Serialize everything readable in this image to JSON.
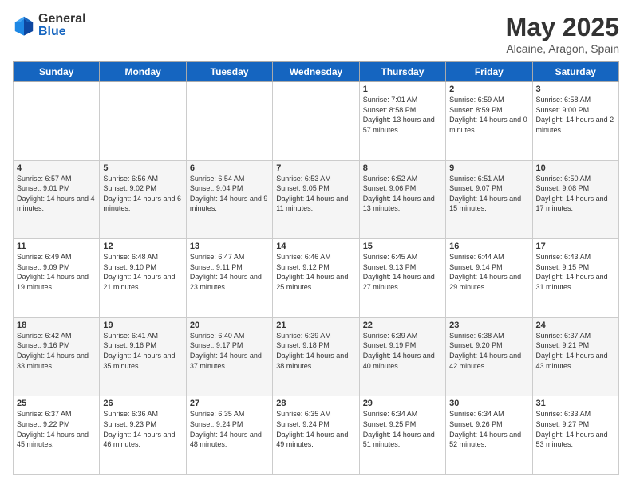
{
  "header": {
    "logo_general": "General",
    "logo_blue": "Blue",
    "title": "May 2025",
    "location": "Alcaine, Aragon, Spain"
  },
  "days_of_week": [
    "Sunday",
    "Monday",
    "Tuesday",
    "Wednesday",
    "Thursday",
    "Friday",
    "Saturday"
  ],
  "weeks": [
    [
      {
        "day": "",
        "sunrise": "",
        "sunset": "",
        "daylight": ""
      },
      {
        "day": "",
        "sunrise": "",
        "sunset": "",
        "daylight": ""
      },
      {
        "day": "",
        "sunrise": "",
        "sunset": "",
        "daylight": ""
      },
      {
        "day": "",
        "sunrise": "",
        "sunset": "",
        "daylight": ""
      },
      {
        "day": "1",
        "sunrise": "Sunrise: 7:01 AM",
        "sunset": "Sunset: 8:58 PM",
        "daylight": "Daylight: 13 hours and 57 minutes."
      },
      {
        "day": "2",
        "sunrise": "Sunrise: 6:59 AM",
        "sunset": "Sunset: 8:59 PM",
        "daylight": "Daylight: 14 hours and 0 minutes."
      },
      {
        "day": "3",
        "sunrise": "Sunrise: 6:58 AM",
        "sunset": "Sunset: 9:00 PM",
        "daylight": "Daylight: 14 hours and 2 minutes."
      }
    ],
    [
      {
        "day": "4",
        "sunrise": "Sunrise: 6:57 AM",
        "sunset": "Sunset: 9:01 PM",
        "daylight": "Daylight: 14 hours and 4 minutes."
      },
      {
        "day": "5",
        "sunrise": "Sunrise: 6:56 AM",
        "sunset": "Sunset: 9:02 PM",
        "daylight": "Daylight: 14 hours and 6 minutes."
      },
      {
        "day": "6",
        "sunrise": "Sunrise: 6:54 AM",
        "sunset": "Sunset: 9:04 PM",
        "daylight": "Daylight: 14 hours and 9 minutes."
      },
      {
        "day": "7",
        "sunrise": "Sunrise: 6:53 AM",
        "sunset": "Sunset: 9:05 PM",
        "daylight": "Daylight: 14 hours and 11 minutes."
      },
      {
        "day": "8",
        "sunrise": "Sunrise: 6:52 AM",
        "sunset": "Sunset: 9:06 PM",
        "daylight": "Daylight: 14 hours and 13 minutes."
      },
      {
        "day": "9",
        "sunrise": "Sunrise: 6:51 AM",
        "sunset": "Sunset: 9:07 PM",
        "daylight": "Daylight: 14 hours and 15 minutes."
      },
      {
        "day": "10",
        "sunrise": "Sunrise: 6:50 AM",
        "sunset": "Sunset: 9:08 PM",
        "daylight": "Daylight: 14 hours and 17 minutes."
      }
    ],
    [
      {
        "day": "11",
        "sunrise": "Sunrise: 6:49 AM",
        "sunset": "Sunset: 9:09 PM",
        "daylight": "Daylight: 14 hours and 19 minutes."
      },
      {
        "day": "12",
        "sunrise": "Sunrise: 6:48 AM",
        "sunset": "Sunset: 9:10 PM",
        "daylight": "Daylight: 14 hours and 21 minutes."
      },
      {
        "day": "13",
        "sunrise": "Sunrise: 6:47 AM",
        "sunset": "Sunset: 9:11 PM",
        "daylight": "Daylight: 14 hours and 23 minutes."
      },
      {
        "day": "14",
        "sunrise": "Sunrise: 6:46 AM",
        "sunset": "Sunset: 9:12 PM",
        "daylight": "Daylight: 14 hours and 25 minutes."
      },
      {
        "day": "15",
        "sunrise": "Sunrise: 6:45 AM",
        "sunset": "Sunset: 9:13 PM",
        "daylight": "Daylight: 14 hours and 27 minutes."
      },
      {
        "day": "16",
        "sunrise": "Sunrise: 6:44 AM",
        "sunset": "Sunset: 9:14 PM",
        "daylight": "Daylight: 14 hours and 29 minutes."
      },
      {
        "day": "17",
        "sunrise": "Sunrise: 6:43 AM",
        "sunset": "Sunset: 9:15 PM",
        "daylight": "Daylight: 14 hours and 31 minutes."
      }
    ],
    [
      {
        "day": "18",
        "sunrise": "Sunrise: 6:42 AM",
        "sunset": "Sunset: 9:16 PM",
        "daylight": "Daylight: 14 hours and 33 minutes."
      },
      {
        "day": "19",
        "sunrise": "Sunrise: 6:41 AM",
        "sunset": "Sunset: 9:16 PM",
        "daylight": "Daylight: 14 hours and 35 minutes."
      },
      {
        "day": "20",
        "sunrise": "Sunrise: 6:40 AM",
        "sunset": "Sunset: 9:17 PM",
        "daylight": "Daylight: 14 hours and 37 minutes."
      },
      {
        "day": "21",
        "sunrise": "Sunrise: 6:39 AM",
        "sunset": "Sunset: 9:18 PM",
        "daylight": "Daylight: 14 hours and 38 minutes."
      },
      {
        "day": "22",
        "sunrise": "Sunrise: 6:39 AM",
        "sunset": "Sunset: 9:19 PM",
        "daylight": "Daylight: 14 hours and 40 minutes."
      },
      {
        "day": "23",
        "sunrise": "Sunrise: 6:38 AM",
        "sunset": "Sunset: 9:20 PM",
        "daylight": "Daylight: 14 hours and 42 minutes."
      },
      {
        "day": "24",
        "sunrise": "Sunrise: 6:37 AM",
        "sunset": "Sunset: 9:21 PM",
        "daylight": "Daylight: 14 hours and 43 minutes."
      }
    ],
    [
      {
        "day": "25",
        "sunrise": "Sunrise: 6:37 AM",
        "sunset": "Sunset: 9:22 PM",
        "daylight": "Daylight: 14 hours and 45 minutes."
      },
      {
        "day": "26",
        "sunrise": "Sunrise: 6:36 AM",
        "sunset": "Sunset: 9:23 PM",
        "daylight": "Daylight: 14 hours and 46 minutes."
      },
      {
        "day": "27",
        "sunrise": "Sunrise: 6:35 AM",
        "sunset": "Sunset: 9:24 PM",
        "daylight": "Daylight: 14 hours and 48 minutes."
      },
      {
        "day": "28",
        "sunrise": "Sunrise: 6:35 AM",
        "sunset": "Sunset: 9:24 PM",
        "daylight": "Daylight: 14 hours and 49 minutes."
      },
      {
        "day": "29",
        "sunrise": "Sunrise: 6:34 AM",
        "sunset": "Sunset: 9:25 PM",
        "daylight": "Daylight: 14 hours and 51 minutes."
      },
      {
        "day": "30",
        "sunrise": "Sunrise: 6:34 AM",
        "sunset": "Sunset: 9:26 PM",
        "daylight": "Daylight: 14 hours and 52 minutes."
      },
      {
        "day": "31",
        "sunrise": "Sunrise: 6:33 AM",
        "sunset": "Sunset: 9:27 PM",
        "daylight": "Daylight: 14 hours and 53 minutes."
      }
    ]
  ]
}
